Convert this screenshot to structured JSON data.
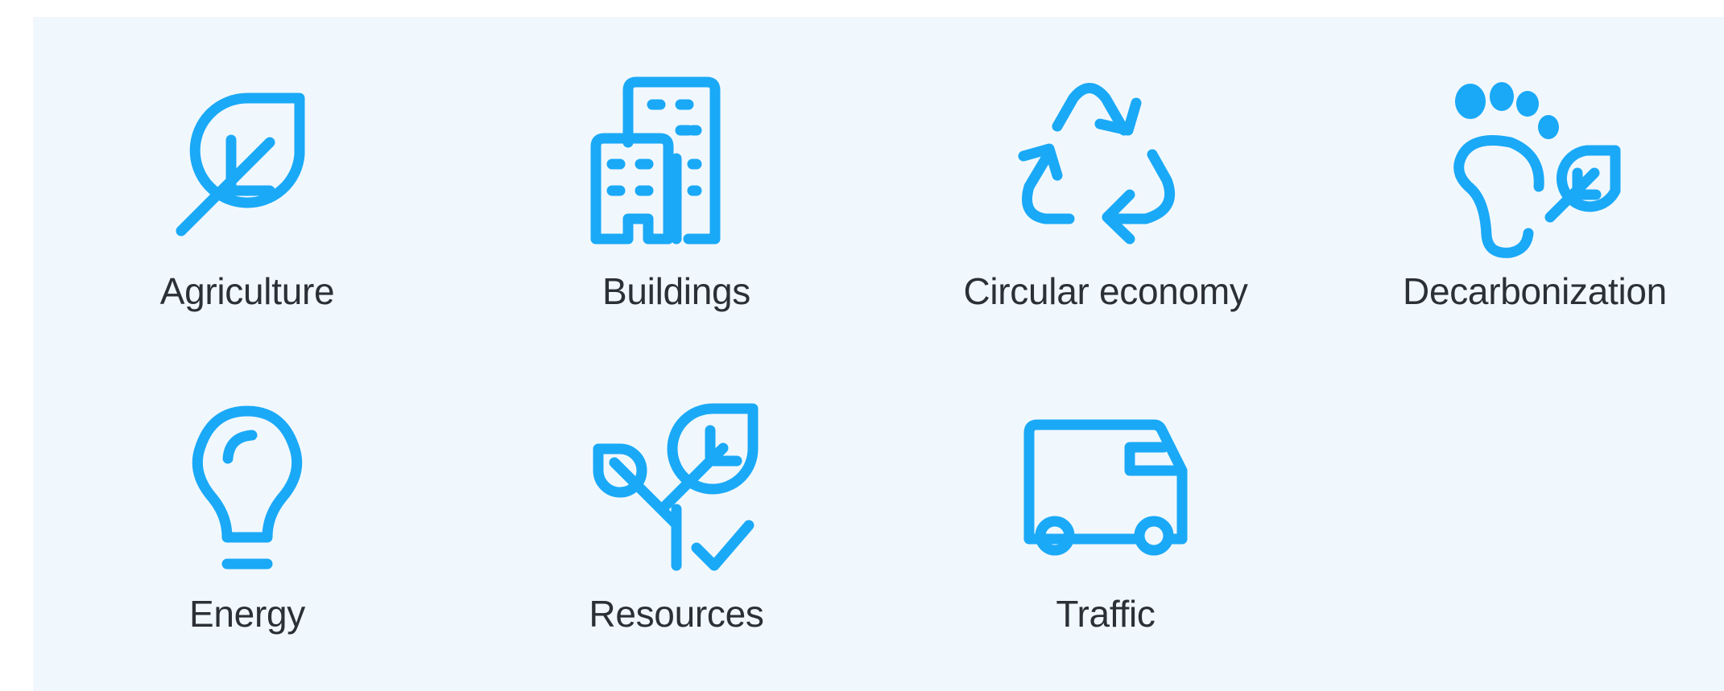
{
  "theme": {
    "background": "#f1f8fd",
    "icon_color": "#1aa9f7",
    "text_color": "#2b2f36"
  },
  "categories": [
    {
      "label": "Agriculture",
      "icon": "leaf-icon"
    },
    {
      "label": "Buildings",
      "icon": "buildings-icon"
    },
    {
      "label": "Circular economy",
      "icon": "recycle-icon"
    },
    {
      "label": "Decarbonization",
      "icon": "footprint-leaf-icon"
    },
    {
      "label": "Energy",
      "icon": "lightbulb-icon"
    },
    {
      "label": "Resources",
      "icon": "plant-check-icon"
    },
    {
      "label": "Traffic",
      "icon": "truck-icon"
    }
  ]
}
